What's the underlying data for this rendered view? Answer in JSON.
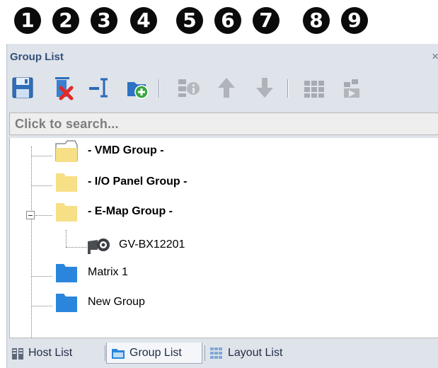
{
  "callouts": [
    "1",
    "2",
    "3",
    "4",
    "5",
    "6",
    "7",
    "8",
    "9"
  ],
  "panel": {
    "title": "Group List",
    "close_glyph": "×"
  },
  "toolbar": {
    "buttons": [
      {
        "icon": "save-icon",
        "enabled": true
      },
      {
        "icon": "delete-icon",
        "enabled": true
      },
      {
        "icon": "rename-icon",
        "enabled": true
      },
      {
        "icon": "add-group-icon",
        "enabled": true
      },
      {
        "icon": "settings-icon",
        "enabled": false
      },
      {
        "icon": "move-up-icon",
        "enabled": false
      },
      {
        "icon": "move-down-icon",
        "enabled": false
      },
      {
        "icon": "layout-icon",
        "enabled": false
      },
      {
        "icon": "play-icon",
        "enabled": false
      }
    ]
  },
  "search": {
    "placeholder": "Click to search..."
  },
  "tree": {
    "items": [
      {
        "label": "- VMD Group -",
        "bold": true,
        "icon": "open-folder-icon",
        "color": "#f7df86"
      },
      {
        "label": "- I/O Panel Group -",
        "bold": true,
        "icon": "folder-icon",
        "color": "#f7df86"
      },
      {
        "label": "- E-Map Group -",
        "bold": true,
        "icon": "folder-icon",
        "color": "#f7df86",
        "expanded": true
      },
      {
        "label": "GV-BX12201",
        "bold": false,
        "icon": "camera-icon"
      },
      {
        "label": "Matrix 1",
        "bold": false,
        "icon": "folder-icon",
        "color": "#2a86dc"
      },
      {
        "label": "New Group",
        "bold": false,
        "icon": "folder-icon",
        "color": "#2a86dc"
      }
    ],
    "expand_glyph": "⊟"
  },
  "tabs": [
    {
      "label": "Host List",
      "active": false,
      "icon": "host-list-icon"
    },
    {
      "label": "Group List",
      "active": true,
      "icon": "group-list-icon"
    },
    {
      "label": "Layout List",
      "active": false,
      "icon": "layout-list-icon"
    }
  ]
}
